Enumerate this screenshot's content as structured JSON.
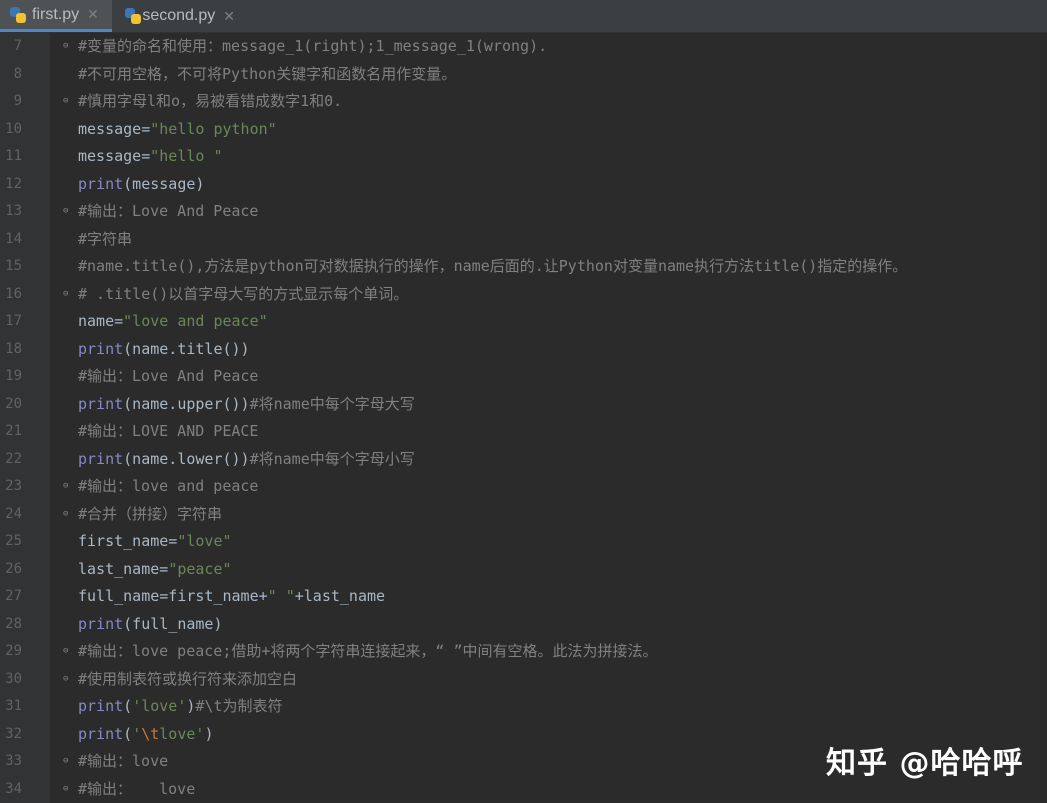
{
  "tabs": [
    {
      "label": "first.py",
      "active": true
    },
    {
      "label": "second.py",
      "active": false
    }
  ],
  "lines": {
    "l7": {
      "num": "7",
      "c": "#变量的命名和使用：message_1(right);1_message_1(wrong)."
    },
    "l8": {
      "num": "8",
      "c": "#不可用空格，不可将Python关键字和函数名用作变量。"
    },
    "l9": {
      "num": "9",
      "c": "#慎用字母l和o，易被看错成数字1和0."
    },
    "l10": {
      "num": "10",
      "a": "message=",
      "s": "\"hello python\""
    },
    "l11": {
      "num": "11",
      "a": "message=",
      "s": "\"hello \""
    },
    "l12": {
      "num": "12",
      "k": "print",
      "r": "(message)"
    },
    "l13": {
      "num": "13",
      "c": "#输出：Love And Peace"
    },
    "l14": {
      "num": "14",
      "c": "#字符串"
    },
    "l15": {
      "num": "15",
      "c": "#name.title(),方法是python可对数据执行的操作，name后面的.让Python对变量name执行方法title()指定的操作。"
    },
    "l16": {
      "num": "16",
      "c": "# .title()以首字母大写的方式显示每个单词。"
    },
    "l17": {
      "num": "17",
      "a": "name=",
      "s": "\"love and peace\""
    },
    "l18": {
      "num": "18",
      "k": "print",
      "r": "(name.title())"
    },
    "l19": {
      "num": "19",
      "c": "#输出：Love And Peace"
    },
    "l20": {
      "num": "20",
      "k": "print",
      "r": "(name.upper())",
      "c": "#将name中每个字母大写"
    },
    "l21": {
      "num": "21",
      "c": "#输出：LOVE AND PEACE"
    },
    "l22": {
      "num": "22",
      "k": "print",
      "r": "(name.lower())",
      "c": "#将name中每个字母小写"
    },
    "l23": {
      "num": "23",
      "c": "#输出：love and peace"
    },
    "l24": {
      "num": "24",
      "c": "#合并（拼接）字符串"
    },
    "l25": {
      "num": "25",
      "a": "first_name=",
      "s": "\"love\""
    },
    "l26": {
      "num": "26",
      "a": "last_name=",
      "s": "\"peace\""
    },
    "l27": {
      "num": "27",
      "a": "full_name=first_name+",
      "s": "\" \"",
      "b": "+last_name"
    },
    "l28": {
      "num": "28",
      "k": "print",
      "r": "(full_name)"
    },
    "l29": {
      "num": "29",
      "c": "#输出：love peace;借助+将两个字符串连接起来，“ ”中间有空格。此法为拼接法。"
    },
    "l30": {
      "num": "30",
      "c": "#使用制表符或换行符来添加空白"
    },
    "l31": {
      "num": "31",
      "k": "print",
      "p1": "(",
      "s": "'love'",
      "p2": ")",
      "c": "#\\t为制表符"
    },
    "l32": {
      "num": "32",
      "k": "print",
      "p1": "(",
      "s1": "'",
      "e": "\\t",
      "s2": "love'",
      "p2": ")"
    },
    "l33": {
      "num": "33",
      "c": "#输出：love"
    },
    "l34": {
      "num": "34",
      "c": "#输出：   love"
    }
  },
  "watermark": "知乎 @哈哈呼"
}
